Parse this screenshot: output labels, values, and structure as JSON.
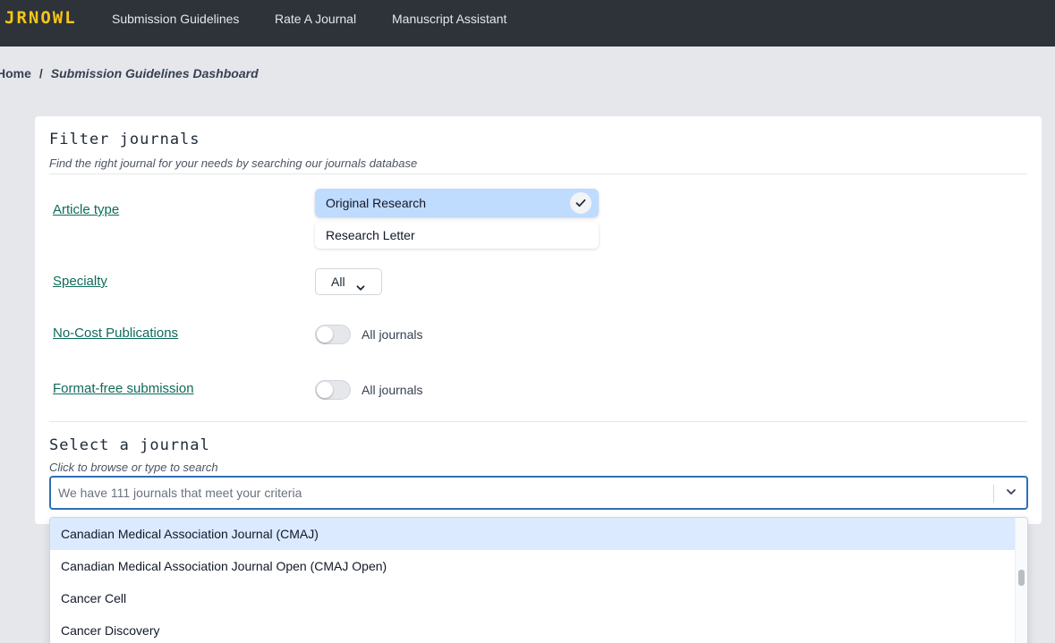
{
  "nav": {
    "logo": "JRNOWL",
    "links": [
      "Submission Guidelines",
      "Rate A Journal",
      "Manuscript Assistant"
    ]
  },
  "breadcrumb": {
    "home": "Home",
    "separator": "/",
    "current": "Submission Guidelines Dashboard"
  },
  "filter": {
    "title": "Filter journals",
    "subtitle": "Find the right journal for your needs by searching our journals database",
    "article_type": {
      "label": "Article type",
      "options": [
        {
          "label": "Original Research",
          "selected": true
        },
        {
          "label": "Research Letter",
          "selected": false
        }
      ]
    },
    "specialty": {
      "label": "Specialty",
      "value": "All"
    },
    "no_cost": {
      "label": "No-Cost Publications",
      "toggle_on": false,
      "status": "All journals"
    },
    "format_free": {
      "label": "Format-free submission",
      "toggle_on": false,
      "status": "All journals"
    }
  },
  "select_journal": {
    "title": "Select a journal",
    "subtitle": "Click to browse or type to search",
    "placeholder": "We have 111 journals that meet your criteria",
    "options": [
      "Canadian Medical Association Journal (CMAJ)",
      "Canadian Medical Association Journal Open (CMAJ Open)",
      "Cancer Cell",
      "Cancer Discovery"
    ]
  },
  "colors": {
    "nav_bg": "#2d3338",
    "logo": "#f5c518",
    "link_green": "#0f6b5a",
    "selected_bg": "#bfdbfe",
    "focus_border": "#2f6fb7"
  }
}
